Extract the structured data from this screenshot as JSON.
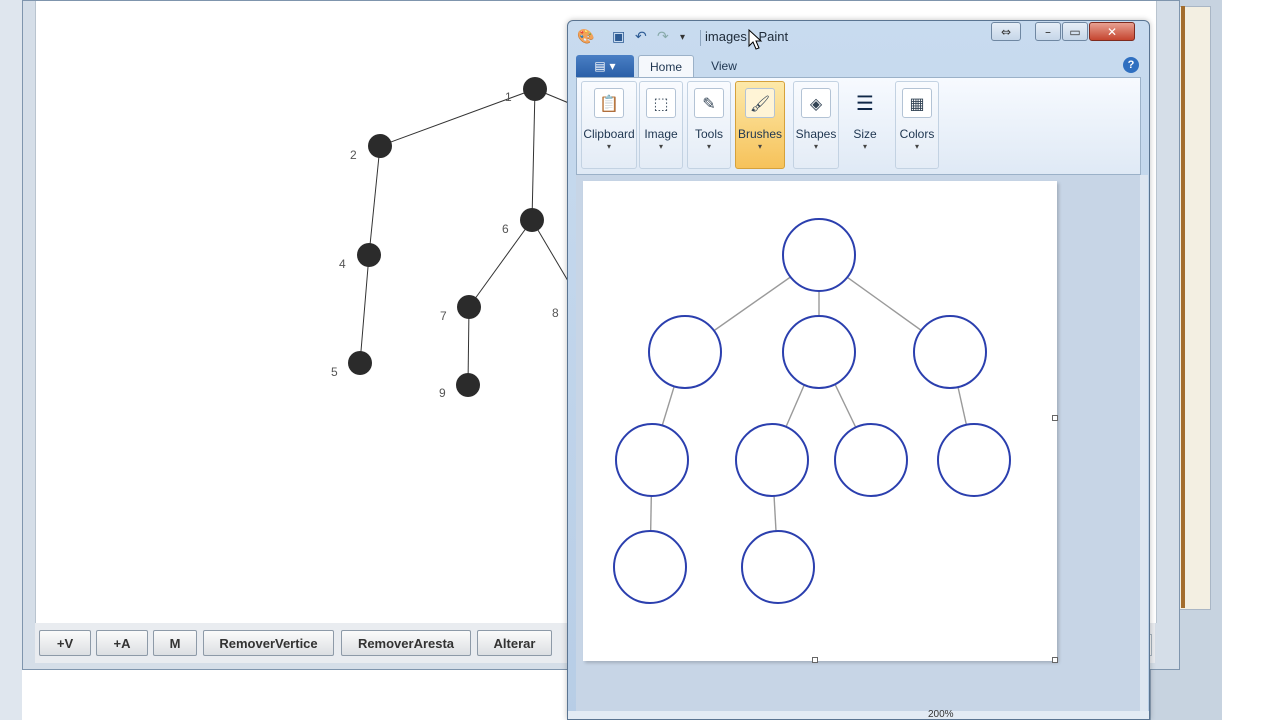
{
  "graph_app": {
    "buttons": [
      {
        "label": "+V"
      },
      {
        "label": "+A"
      },
      {
        "label": "M"
      },
      {
        "label": "RemoverVertice"
      },
      {
        "label": "RemoverAresta"
      },
      {
        "label": "Alterar"
      }
    ],
    "vertex_labels": [
      "1",
      "2",
      "4",
      "5",
      "6",
      "7",
      "8",
      "9"
    ]
  },
  "paint": {
    "title": "images - Paint",
    "tabs": [
      {
        "label": "Home"
      },
      {
        "label": "View"
      }
    ],
    "ribbon_groups": [
      {
        "label": "Clipboard",
        "icon": "clipboard-icon"
      },
      {
        "label": "Image",
        "icon": "image-select-icon"
      },
      {
        "label": "Tools",
        "icon": "tools-icon"
      },
      {
        "label": "Brushes",
        "icon": "brushes-icon",
        "active": true
      },
      {
        "label": "Shapes",
        "icon": "shapes-icon"
      },
      {
        "label": "Size",
        "icon": "size-icon"
      },
      {
        "label": "Colors",
        "icon": "colors-icon"
      }
    ],
    "status": {
      "zoom": "200%"
    }
  },
  "colors": {
    "node_fill": "#2b2b2b",
    "paint_circle_stroke": "#2b3fae",
    "paint_accent": "#2a5fa8",
    "active_group": "#f6c25a"
  }
}
